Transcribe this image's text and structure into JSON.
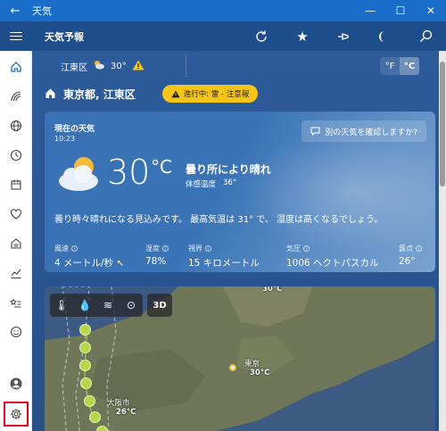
{
  "titlebar": {
    "title": "天気"
  },
  "appbar": {
    "title": "天気予報"
  },
  "location_bar": {
    "location": "江東区",
    "temp": "30°",
    "unit_f": "°F",
    "unit_c": "°C"
  },
  "city": {
    "name": "東京都, 江東区",
    "alert": "進行中: 雷 - 注意報"
  },
  "current": {
    "label": "現在の天気",
    "time": "10:23",
    "ask_label": "別の天気を確認しますか?",
    "temp": "30",
    "unit": "°C",
    "condition": "曇り所により晴れ",
    "feels_label": "体感温度",
    "feels_value": "36°",
    "summary": "曇り時々晴れになる見込みです。 最高気温は 31° で、 湿度は高くなるでしょう。",
    "stats": [
      {
        "label": "風速",
        "value": "4 メートル/秒"
      },
      {
        "label": "湿度",
        "value": "78%"
      },
      {
        "label": "視界",
        "value": "15 キロメートル"
      },
      {
        "label": "気圧",
        "value": "1006 ヘクトパスカル"
      },
      {
        "label": "露点",
        "value": "26°"
      }
    ]
  },
  "map": {
    "btn_3d": "3D",
    "labels": [
      {
        "name": "東京",
        "temp": "30°C"
      },
      {
        "name": "大阪市",
        "temp": "26°C"
      }
    ],
    "top_temp": "30°C"
  },
  "icons": {
    "weather": "partly-cloudy",
    "alert": "warning-triangle"
  },
  "colors": {
    "accent": "#1a6dc8",
    "alert": "#f5c518",
    "highlight": "#e0001b"
  }
}
